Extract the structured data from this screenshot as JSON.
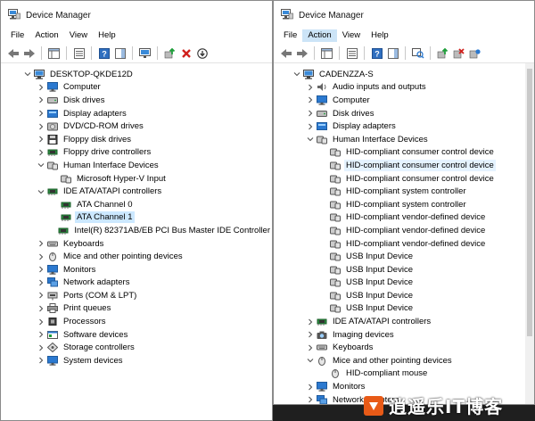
{
  "left": {
    "title": "Device Manager",
    "menu": [
      "File",
      "Action",
      "View",
      "Help"
    ],
    "rows": [
      {
        "label": "DESKTOP-QKDE12D",
        "level": 0,
        "exp": "open",
        "icon": "computer"
      },
      {
        "label": "Computer",
        "level": 1,
        "exp": "closed",
        "icon": "monitor"
      },
      {
        "label": "Disk drives",
        "level": 1,
        "exp": "closed",
        "icon": "drive"
      },
      {
        "label": "Display adapters",
        "level": 1,
        "exp": "closed",
        "icon": "display"
      },
      {
        "label": "DVD/CD-ROM drives",
        "level": 1,
        "exp": "closed",
        "icon": "disc"
      },
      {
        "label": "Floppy disk drives",
        "level": 1,
        "exp": "closed",
        "icon": "floppy"
      },
      {
        "label": "Floppy drive controllers",
        "level": 1,
        "exp": "closed",
        "icon": "chip"
      },
      {
        "label": "Human Interface Devices",
        "level": 1,
        "exp": "open",
        "icon": "hid"
      },
      {
        "label": "Microsoft Hyper-V Input",
        "level": 2,
        "exp": "none",
        "icon": "hid"
      },
      {
        "label": "IDE ATA/ATAPI controllers",
        "level": 1,
        "exp": "open",
        "icon": "chip"
      },
      {
        "label": "ATA Channel 0",
        "level": 2,
        "exp": "none",
        "icon": "chip"
      },
      {
        "label": "ATA Channel 1",
        "level": 2,
        "exp": "none",
        "icon": "chip",
        "state": "sel"
      },
      {
        "label": "Intel(R) 82371AB/EB PCI Bus Master IDE Controller",
        "level": 2,
        "exp": "none",
        "icon": "chip"
      },
      {
        "label": "Keyboards",
        "level": 1,
        "exp": "closed",
        "icon": "keyboard"
      },
      {
        "label": "Mice and other pointing devices",
        "level": 1,
        "exp": "closed",
        "icon": "mouse"
      },
      {
        "label": "Monitors",
        "level": 1,
        "exp": "closed",
        "icon": "monitor"
      },
      {
        "label": "Network adapters",
        "level": 1,
        "exp": "closed",
        "icon": "network"
      },
      {
        "label": "Ports (COM & LPT)",
        "level": 1,
        "exp": "closed",
        "icon": "port"
      },
      {
        "label": "Print queues",
        "level": 1,
        "exp": "closed",
        "icon": "printer"
      },
      {
        "label": "Processors",
        "level": 1,
        "exp": "closed",
        "icon": "cpu"
      },
      {
        "label": "Software devices",
        "level": 1,
        "exp": "closed",
        "icon": "software"
      },
      {
        "label": "Storage controllers",
        "level": 1,
        "exp": "closed",
        "icon": "storage"
      },
      {
        "label": "System devices",
        "level": 1,
        "exp": "closed",
        "icon": "monitor"
      }
    ]
  },
  "right": {
    "title": "Device Manager",
    "menu": [
      "File",
      "Action",
      "View",
      "Help"
    ],
    "rows": [
      {
        "label": "CADENZZA-S",
        "level": 0,
        "exp": "open",
        "icon": "computer"
      },
      {
        "label": "Audio inputs and outputs",
        "level": 1,
        "exp": "closed",
        "icon": "audio"
      },
      {
        "label": "Computer",
        "level": 1,
        "exp": "closed",
        "icon": "monitor"
      },
      {
        "label": "Disk drives",
        "level": 1,
        "exp": "closed",
        "icon": "drive"
      },
      {
        "label": "Display adapters",
        "level": 1,
        "exp": "closed",
        "icon": "display"
      },
      {
        "label": "Human Interface Devices",
        "level": 1,
        "exp": "open",
        "icon": "hid"
      },
      {
        "label": "HID-compliant consumer control device",
        "level": 2,
        "exp": "none",
        "icon": "hid"
      },
      {
        "label": "HID-compliant consumer control device",
        "level": 2,
        "exp": "none",
        "icon": "hid",
        "state": "hl"
      },
      {
        "label": "HID-compliant consumer control device",
        "level": 2,
        "exp": "none",
        "icon": "hid"
      },
      {
        "label": "HID-compliant system controller",
        "level": 2,
        "exp": "none",
        "icon": "hid"
      },
      {
        "label": "HID-compliant system controller",
        "level": 2,
        "exp": "none",
        "icon": "hid"
      },
      {
        "label": "HID-compliant vendor-defined device",
        "level": 2,
        "exp": "none",
        "icon": "hid"
      },
      {
        "label": "HID-compliant vendor-defined device",
        "level": 2,
        "exp": "none",
        "icon": "hid"
      },
      {
        "label": "HID-compliant vendor-defined device",
        "level": 2,
        "exp": "none",
        "icon": "hid"
      },
      {
        "label": "USB Input Device",
        "level": 2,
        "exp": "none",
        "icon": "hid"
      },
      {
        "label": "USB Input Device",
        "level": 2,
        "exp": "none",
        "icon": "hid"
      },
      {
        "label": "USB Input Device",
        "level": 2,
        "exp": "none",
        "icon": "hid"
      },
      {
        "label": "USB Input Device",
        "level": 2,
        "exp": "none",
        "icon": "hid"
      },
      {
        "label": "USB Input Device",
        "level": 2,
        "exp": "none",
        "icon": "hid"
      },
      {
        "label": "IDE ATA/ATAPI controllers",
        "level": 1,
        "exp": "closed",
        "icon": "chip"
      },
      {
        "label": "Imaging devices",
        "level": 1,
        "exp": "closed",
        "icon": "camera"
      },
      {
        "label": "Keyboards",
        "level": 1,
        "exp": "closed",
        "icon": "keyboard"
      },
      {
        "label": "Mice and other pointing devices",
        "level": 1,
        "exp": "open",
        "icon": "mouse"
      },
      {
        "label": "HID-compliant mouse",
        "level": 2,
        "exp": "none",
        "icon": "mouse"
      },
      {
        "label": "Monitors",
        "level": 1,
        "exp": "closed",
        "icon": "monitor"
      },
      {
        "label": "Network adapters",
        "level": 1,
        "exp": "closed",
        "icon": "network"
      }
    ]
  },
  "watermark": {
    "text": "逍遥乐IT博客"
  },
  "colors": {
    "selected": "#cce8ff",
    "hover": "#e5f3ff",
    "menu_active": "#cce4f7",
    "accent": "#2b79d0",
    "red": "#d0201c",
    "green": "#1e9e3a",
    "watermark_logo": "#e85a17"
  }
}
